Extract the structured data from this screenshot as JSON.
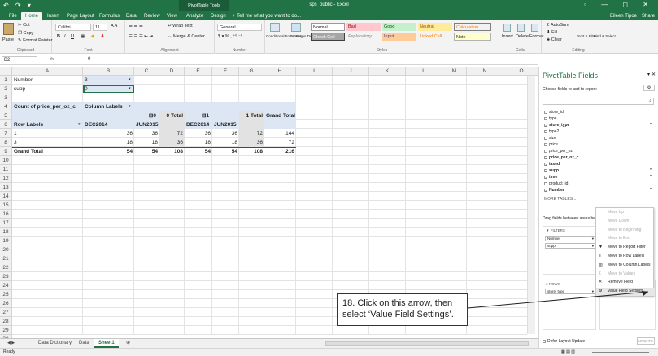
{
  "title_bar": {
    "context_tab": "PivotTable Tools",
    "document": "sps_public - Excel",
    "qat_icons": "↶ ↷ ▾",
    "window_controls": "▫ — ◻ ✕"
  },
  "tabs": [
    "File",
    "Home",
    "Insert",
    "Page Layout",
    "Formulas",
    "Data",
    "Review",
    "View",
    "Analyze",
    "Design"
  ],
  "tell_me": "Tell me what you want to do...",
  "user": "Eileen Tipoe",
  "share": "Share",
  "ribbon": {
    "clipboard": {
      "paste": "Paste",
      "cut": "Cut",
      "copy": "Copy",
      "format_painter": "Format Painter",
      "label": "Clipboard"
    },
    "font": {
      "name": "Calibri",
      "size": "11",
      "label": "Font"
    },
    "alignment": {
      "wrap": "Wrap Text",
      "merge": "Merge & Center",
      "label": "Alignment"
    },
    "number": {
      "format": "General",
      "label": "Number"
    },
    "styles": {
      "conditional": "Conditional Formatting",
      "format_table": "Format as Table",
      "normal": "Normal",
      "bad": "Bad",
      "good": "Good",
      "neutral": "Neutral",
      "calculation": "Calculation",
      "check_cell": "Check Cell",
      "explanatory": "Explanatory ...",
      "input": "Input",
      "linked_cell": "Linked Cell",
      "note": "Note",
      "label": "Styles"
    },
    "cells": {
      "insert": "Insert",
      "delete": "Delete",
      "format": "Format",
      "label": "Cells"
    },
    "editing": {
      "autosum": "AutoSum",
      "fill": "Fill",
      "clear": "Clear",
      "sort": "Sort & Filter",
      "find": "Find & Select",
      "label": "Editing"
    }
  },
  "formula_bar": {
    "name_box": "B2",
    "fx": "fx",
    "value": "0"
  },
  "columns": [
    "A",
    "B",
    "C",
    "D",
    "E",
    "F",
    "G",
    "H",
    "I",
    "J",
    "K",
    "L",
    "M",
    "N",
    "O",
    "P"
  ],
  "rows": [
    "1",
    "2",
    "3",
    "4",
    "5",
    "6",
    "7",
    "8",
    "9",
    "10",
    "11",
    "12",
    "13",
    "14",
    "15",
    "16",
    "17",
    "18",
    "19",
    "20",
    "21",
    "22",
    "23",
    "24",
    "25",
    "26",
    "27",
    "28",
    "29",
    "30"
  ],
  "filters": [
    {
      "label": "Number",
      "value": "3"
    },
    {
      "label": "supp",
      "value": "0"
    }
  ],
  "pivot": {
    "measure": "Count of price_per_oz_c",
    "col_labels": "Column Labels",
    "groups": [
      {
        "sym": "⊟",
        "name": "0"
      },
      {
        "name": "0 Total"
      },
      {
        "sym": "⊟",
        "name": "1"
      },
      {
        "name": "1 Total"
      },
      {
        "name": "Grand Total"
      }
    ],
    "row_labels_hdr": "Row Labels",
    "subcols": [
      "DEC2014",
      "JUN2015",
      "DEC2014",
      "JUN2015"
    ],
    "data": [
      {
        "label": "1",
        "v": [
          "36",
          "36",
          "72",
          "36",
          "36",
          "72",
          "144"
        ]
      },
      {
        "label": "3",
        "v": [
          "18",
          "18",
          "36",
          "18",
          "18",
          "36",
          "72"
        ]
      }
    ],
    "grand": {
      "label": "Grand Total",
      "v": [
        "54",
        "54",
        "108",
        "54",
        "54",
        "108",
        "216"
      ]
    }
  },
  "sheets": [
    "Data Dictionary",
    "Data",
    "Sheet1"
  ],
  "status": "Ready",
  "pivot_pane": {
    "title": "PivotTable Fields",
    "subtitle": "Choose fields to add to report:",
    "search": "Search",
    "fields": [
      {
        "name": "store_id",
        "checked": false
      },
      {
        "name": "type",
        "checked": false
      },
      {
        "name": "store_type",
        "checked": true
      },
      {
        "name": "type2",
        "checked": false
      },
      {
        "name": "size",
        "checked": false
      },
      {
        "name": "price",
        "checked": false
      },
      {
        "name": "price_per_oz",
        "checked": false
      },
      {
        "name": "price_per_oz_c",
        "checked": true
      },
      {
        "name": "taxed",
        "checked": true
      },
      {
        "name": "supp",
        "checked": true
      },
      {
        "name": "time",
        "checked": true
      },
      {
        "name": "product_id",
        "checked": false
      },
      {
        "name": "Number",
        "checked": true
      }
    ],
    "more_tables": "MORE TABLES...",
    "drag_hint": "Drag fields between areas below:",
    "filters_hdr": "FILTERS",
    "filter_items": [
      "Number",
      "supp"
    ],
    "rows_hdr": "ROWS",
    "row_items": [
      "store_type"
    ],
    "value_item": "Count of price_per_oz_c",
    "defer": "Defer Layout Update",
    "update": "UPDATE"
  },
  "context_menu": [
    {
      "label": "Move Up",
      "enabled": false
    },
    {
      "label": "Move Down",
      "enabled": false
    },
    {
      "label": "Move to Beginning",
      "enabled": false
    },
    {
      "label": "Move to End",
      "enabled": false
    },
    {
      "label": "Move to Report Filter",
      "enabled": true
    },
    {
      "label": "Move to Row Labels",
      "enabled": true
    },
    {
      "label": "Move to Column Labels",
      "enabled": true
    },
    {
      "label": "Move to Values",
      "enabled": false
    },
    {
      "label": "Remove Field",
      "enabled": true
    },
    {
      "label": "Value Field Settings...",
      "enabled": true
    }
  ],
  "callout": "18. Click on this arrow, then select ‘Value Field Settings’."
}
